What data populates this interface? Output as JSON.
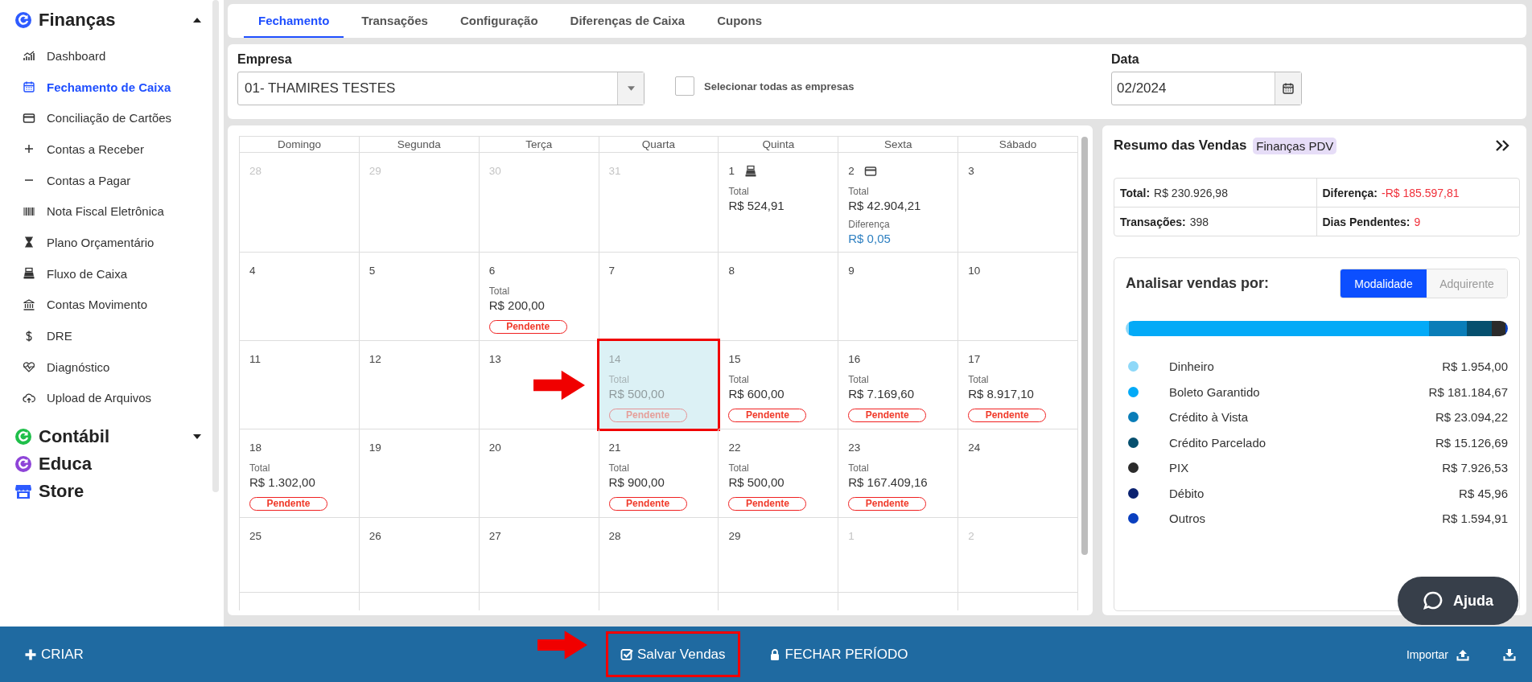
{
  "sidebar": {
    "groups": [
      {
        "title": "Finanças",
        "color": "#2e5bff",
        "kind": "collapsible",
        "expanded": true,
        "items": [
          {
            "label": "Dashboard",
            "selected": false
          },
          {
            "label": "Fechamento de Caixa",
            "selected": true
          },
          {
            "label": "Conciliação de Cartões",
            "selected": false
          },
          {
            "label": "Contas a Receber",
            "selected": false
          },
          {
            "label": "Contas a Pagar",
            "selected": false
          },
          {
            "label": "Nota Fiscal Eletrônica",
            "selected": false
          },
          {
            "label": "Plano Orçamentário",
            "selected": false
          },
          {
            "label": "Fluxo de Caixa",
            "selected": false
          },
          {
            "label": "Contas Movimento",
            "selected": false
          },
          {
            "label": "DRE",
            "selected": false
          },
          {
            "label": "Diagnóstico",
            "selected": false
          },
          {
            "label": "Upload de Arquivos",
            "selected": false
          }
        ]
      },
      {
        "title": "Contábil",
        "color": "#1fbf4a",
        "kind": "collapsible",
        "expanded": false
      },
      {
        "title": "Educa",
        "color": "#8e44d8",
        "kind": "link"
      },
      {
        "title": "Store",
        "color": "#2e5bff",
        "kind": "shop"
      }
    ]
  },
  "tabs": [
    {
      "label": "Fechamento",
      "selected": true
    },
    {
      "label": "Transações",
      "selected": false
    },
    {
      "label": "Configuração",
      "selected": false
    },
    {
      "label": "Diferenças de Caixa",
      "selected": false
    },
    {
      "label": "Cupons",
      "selected": false
    }
  ],
  "filters": {
    "company_label": "Empresa",
    "company_value": "01- THAMIRES TESTES",
    "all_companies": {
      "label": "Selecionar todas as empresas",
      "checked": false
    },
    "date_label": "Data",
    "date_value": "02/2024"
  },
  "calendar": {
    "weekdays": [
      "Domingo",
      "Segunda",
      "Terça",
      "Quarta",
      "Quinta",
      "Sexta",
      "Sábado"
    ],
    "weeks": [
      {
        "days": [
          {
            "day": "28",
            "outside": true,
            "selected": false,
            "marked": false
          },
          {
            "day": "29",
            "outside": true,
            "selected": false,
            "marked": false
          },
          {
            "day": "30",
            "outside": true,
            "selected": false,
            "marked": false
          },
          {
            "day": "31",
            "outside": true,
            "selected": false,
            "marked": false
          },
          {
            "day": "1",
            "outside": false,
            "selected": false,
            "marked": false,
            "kind": "cash",
            "total_label": "Total",
            "total": "R$ 524,91"
          },
          {
            "day": "2",
            "outside": false,
            "selected": false,
            "marked": false,
            "kind": "card",
            "total_label": "Total",
            "total": "R$ 42.904,21",
            "difference_label": "Diferença",
            "difference": "R$ 0,05"
          },
          {
            "day": "3",
            "outside": false,
            "selected": false,
            "marked": false
          }
        ]
      },
      {
        "days": [
          {
            "day": "4",
            "outside": false,
            "selected": false,
            "marked": false
          },
          {
            "day": "5",
            "outside": false,
            "selected": false,
            "marked": false
          },
          {
            "day": "6",
            "outside": false,
            "selected": false,
            "marked": false,
            "total_label": "Total",
            "total": "R$ 200,00",
            "status": "Pendente"
          },
          {
            "day": "7",
            "outside": false,
            "selected": false,
            "marked": false
          },
          {
            "day": "8",
            "outside": false,
            "selected": false,
            "marked": false
          },
          {
            "day": "9",
            "outside": false,
            "selected": false,
            "marked": false
          },
          {
            "day": "10",
            "outside": false,
            "selected": false,
            "marked": false
          }
        ]
      },
      {
        "days": [
          {
            "day": "11",
            "outside": false,
            "selected": false,
            "marked": false
          },
          {
            "day": "12",
            "outside": false,
            "selected": false,
            "marked": false
          },
          {
            "day": "13",
            "outside": false,
            "selected": false,
            "marked": false
          },
          {
            "day": "14",
            "outside": false,
            "selected": true,
            "marked": true,
            "total_label": "Total",
            "total": "R$ 500,00",
            "status": "Pendente"
          },
          {
            "day": "15",
            "outside": false,
            "selected": false,
            "marked": false,
            "total_label": "Total",
            "total": "R$ 600,00",
            "status": "Pendente"
          },
          {
            "day": "16",
            "outside": false,
            "selected": false,
            "marked": false,
            "total_label": "Total",
            "total": "R$ 7.169,60",
            "status": "Pendente"
          },
          {
            "day": "17",
            "outside": false,
            "selected": false,
            "marked": false,
            "total_label": "Total",
            "total": "R$ 8.917,10",
            "status": "Pendente"
          }
        ]
      },
      {
        "days": [
          {
            "day": "18",
            "outside": false,
            "selected": false,
            "marked": false,
            "total_label": "Total",
            "total": "R$ 1.302,00",
            "status": "Pendente"
          },
          {
            "day": "19",
            "outside": false,
            "selected": false,
            "marked": false
          },
          {
            "day": "20",
            "outside": false,
            "selected": false,
            "marked": false
          },
          {
            "day": "21",
            "outside": false,
            "selected": false,
            "marked": false,
            "total_label": "Total",
            "total": "R$ 900,00",
            "status": "Pendente"
          },
          {
            "day": "22",
            "outside": false,
            "selected": false,
            "marked": false,
            "total_label": "Total",
            "total": "R$ 500,00",
            "status": "Pendente"
          },
          {
            "day": "23",
            "outside": false,
            "selected": false,
            "marked": false,
            "total_label": "Total",
            "total": "R$ 167.409,16",
            "status": "Pendente"
          },
          {
            "day": "24",
            "outside": false,
            "selected": false,
            "marked": false
          }
        ]
      },
      {
        "days": [
          {
            "day": "25",
            "outside": false,
            "selected": false,
            "marked": false
          },
          {
            "day": "26",
            "outside": false,
            "selected": false,
            "marked": false
          },
          {
            "day": "27",
            "outside": false,
            "selected": false,
            "marked": false
          },
          {
            "day": "28",
            "outside": false,
            "selected": false,
            "marked": false
          },
          {
            "day": "29",
            "outside": false,
            "selected": false,
            "marked": false
          },
          {
            "day": "1",
            "outside": true,
            "selected": false,
            "marked": false
          },
          {
            "day": "2",
            "outside": true,
            "selected": false,
            "marked": false
          }
        ]
      }
    ]
  },
  "summary": {
    "title": "Resumo das Vendas",
    "badge": "Finanças PDV",
    "stats": [
      {
        "label": "Total:",
        "value": "R$ 230.926,98",
        "alert": false
      },
      {
        "label": "Diferença:",
        "value": "-R$ 185.597,81",
        "alert": true
      },
      {
        "label": "Transações:",
        "value": "398",
        "alert": false
      },
      {
        "label": "Dias Pendentes:",
        "value": "9",
        "alert": true
      }
    ],
    "analysis_title": "Analisar vendas por:",
    "options": [
      {
        "label": "Modalidade",
        "selected": true
      },
      {
        "label": "Adquirente",
        "selected": false
      }
    ],
    "legend": [
      {
        "name": "Dinheiro",
        "value": "R$ 1.954,00",
        "color": "#8ed8f8"
      },
      {
        "name": "Boleto Garantido",
        "value": "R$ 181.184,67",
        "color": "#03aaf7"
      },
      {
        "name": "Crédito à Vista",
        "value": "R$ 23.094,22",
        "color": "#0a7db8"
      },
      {
        "name": "Crédito Parcelado",
        "value": "R$ 15.126,69",
        "color": "#064f6e"
      },
      {
        "name": "PIX",
        "value": "R$ 7.926,53",
        "color": "#2b2b2b"
      },
      {
        "name": "Débito",
        "value": "R$ 45,96",
        "color": "#0b2270"
      },
      {
        "name": "Outros",
        "value": "R$ 1.594,91",
        "color": "#0a3fbf"
      }
    ]
  },
  "help_button": "Ajuda",
  "bottom_bar": {
    "create": "CRIAR",
    "save": {
      "label": "Salvar Vendas",
      "marked": true
    },
    "close_period": "FECHAR PERÍODO",
    "import": "Importar"
  }
}
